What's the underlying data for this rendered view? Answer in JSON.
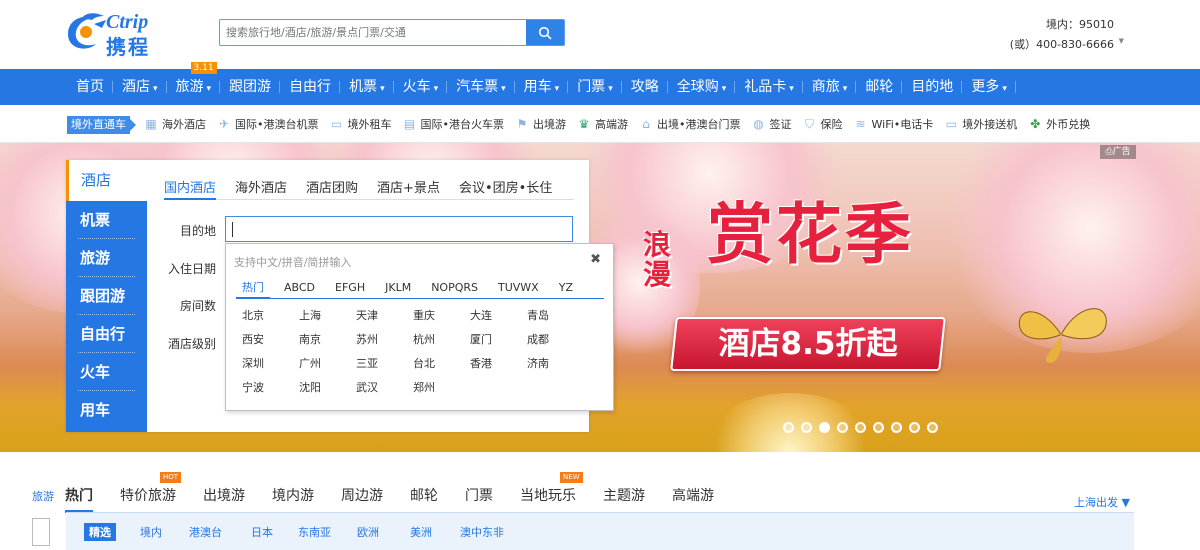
{
  "header": {
    "brand_en": "Ctrip",
    "brand_cn": "携程",
    "search_placeholder": "搜索旅行地/酒店/旅游/景点门票/交通",
    "hotline_domestic": "境内：95010",
    "hotline_alt": "(或）400-830-6666"
  },
  "nav": {
    "items": [
      {
        "label": "首页",
        "dd": ""
      },
      {
        "label": "酒店",
        "dd": "▾"
      },
      {
        "label": "旅游",
        "dd": "▾",
        "tag": "3.11"
      },
      {
        "label": "跟团游",
        "dd": ""
      },
      {
        "label": "自由行",
        "dd": ""
      },
      {
        "label": "机票",
        "dd": "▾"
      },
      {
        "label": "火车",
        "dd": "▾"
      },
      {
        "label": "汽车票",
        "dd": "▾"
      },
      {
        "label": "用车",
        "dd": "▾"
      },
      {
        "label": "门票",
        "dd": "▾"
      },
      {
        "label": "攻略",
        "dd": ""
      },
      {
        "label": "全球购",
        "dd": "▾"
      },
      {
        "label": "礼品卡",
        "dd": "▾"
      },
      {
        "label": "商旅",
        "dd": "▾"
      },
      {
        "label": "邮轮",
        "dd": ""
      },
      {
        "label": "目的地",
        "dd": ""
      },
      {
        "label": "更多",
        "dd": "▾"
      }
    ]
  },
  "subnav": {
    "label": "境外直通车",
    "items": [
      {
        "label": "海外酒店",
        "icon": "hotel-icon"
      },
      {
        "label": "国际•港澳台机票",
        "icon": "plane-icon"
      },
      {
        "label": "境外租车",
        "icon": "car-icon"
      },
      {
        "label": "国际•港台火车票",
        "icon": "train-icon"
      },
      {
        "label": "出境游",
        "icon": "flag-icon"
      },
      {
        "label": "高端游",
        "icon": "crown-icon"
      },
      {
        "label": "出境•港澳台门票",
        "icon": "temple-icon"
      },
      {
        "label": "签证",
        "icon": "globe-icon"
      },
      {
        "label": "保险",
        "icon": "shield-icon"
      },
      {
        "label": "WiFi•电话卡",
        "icon": "wifi-icon"
      },
      {
        "label": "境外接送机",
        "icon": "car-icon"
      },
      {
        "label": "外币兑换",
        "icon": "currency-icon"
      }
    ]
  },
  "banner": {
    "ad_label": "广告",
    "promo_small": "浪漫",
    "promo_big": "赏花季",
    "promo_ribbon": "酒店8.5折起"
  },
  "panel": {
    "side": [
      "酒店",
      "机票",
      "旅游",
      "跟团游",
      "自由行",
      "火车",
      "用车"
    ],
    "tabs": [
      "国内酒店",
      "海外酒店",
      "酒店团购",
      "酒店+景点",
      "会议•团房•长住"
    ],
    "labels": {
      "dest": "目的地",
      "checkin": "入住日期",
      "rooms": "房间数",
      "level": "酒店级别"
    }
  },
  "popup": {
    "tip": "支持中文/拼音/简拼输入",
    "close": "✖",
    "tabs": [
      "热门",
      "ABCD",
      "EFGH",
      "JKLM",
      "NOPQRS",
      "TUVWX",
      "YZ"
    ],
    "cities": [
      "北京",
      "上海",
      "天津",
      "重庆",
      "大连",
      "青岛",
      "西安",
      "南京",
      "苏州",
      "杭州",
      "厦门",
      "成都",
      "深圳",
      "广州",
      "三亚",
      "台北",
      "香港",
      "济南",
      "宁波",
      "沈阳",
      "武汉",
      "郑州"
    ]
  },
  "bottom": {
    "section_tag": "旅游",
    "city": "上海出发",
    "categories": [
      {
        "label": "热门"
      },
      {
        "label": "特价旅游",
        "badge": "HOT",
        "badge_color": "#f57d18"
      },
      {
        "label": "出境游"
      },
      {
        "label": "境内游"
      },
      {
        "label": "周边游"
      },
      {
        "label": "邮轮"
      },
      {
        "label": "门票"
      },
      {
        "label": "当地玩乐",
        "badge": "NEW",
        "badge_color": "#f57d18"
      },
      {
        "label": "主题游"
      },
      {
        "label": "高端游"
      }
    ],
    "filters": [
      "精选",
      "境内",
      "港澳台",
      "日本",
      "东南亚",
      "欧洲",
      "美洲",
      "澳中东非"
    ]
  },
  "colors": {
    "brand": "#2577e3",
    "accent": "#f69200",
    "promo_red": "#e6213e"
  }
}
